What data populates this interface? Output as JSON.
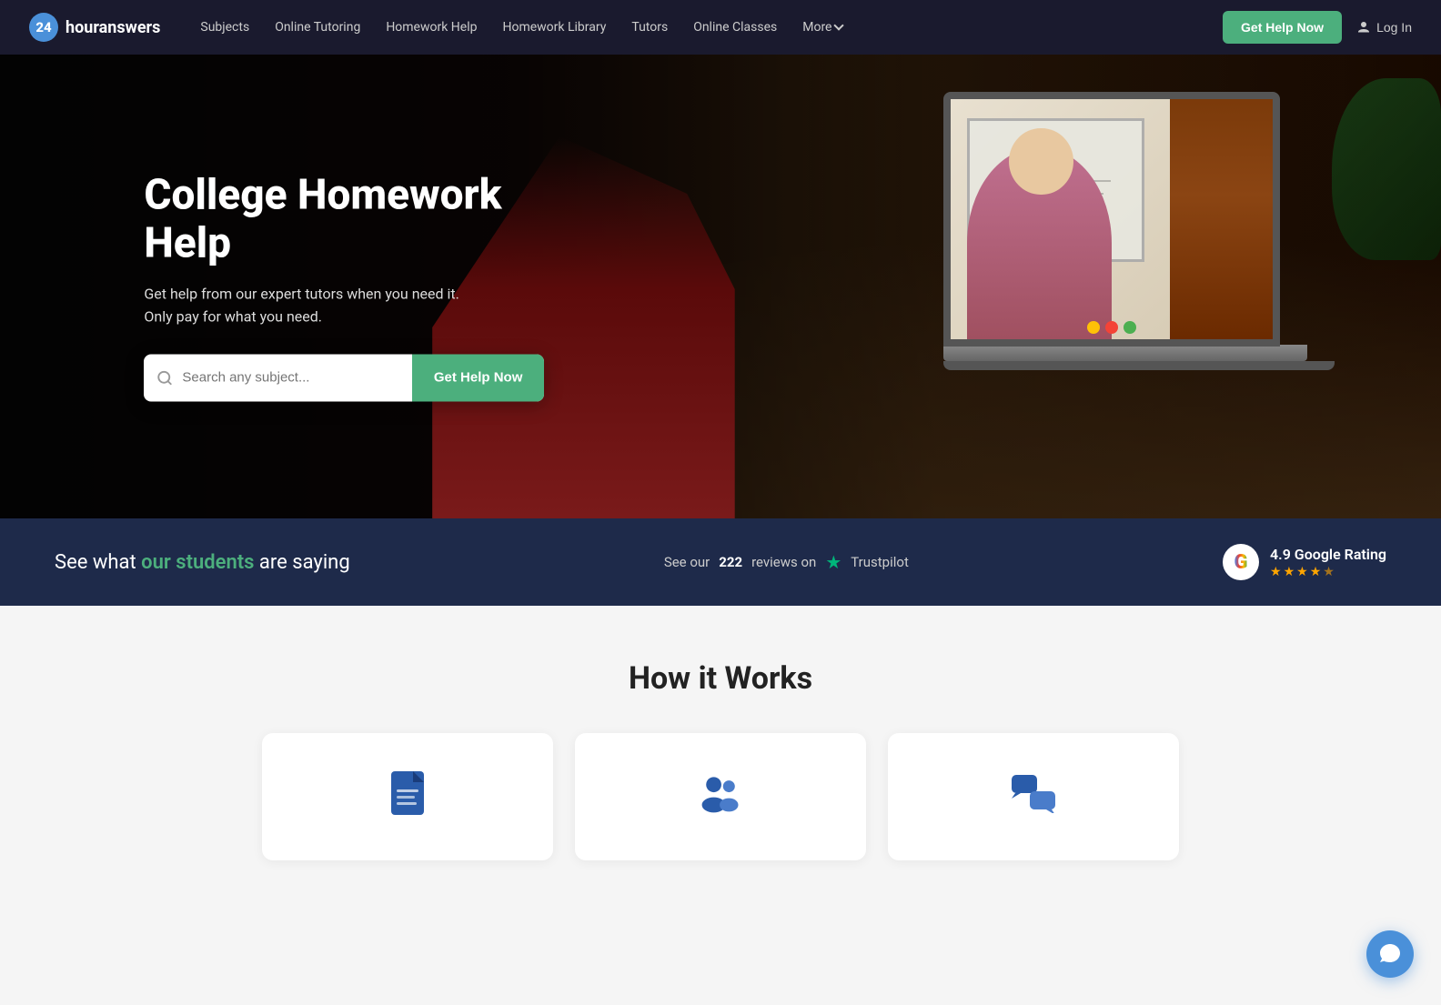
{
  "brand": {
    "badge": "24",
    "name_part1": "hour",
    "name_part2": "answers"
  },
  "navbar": {
    "links": [
      {
        "label": "Subjects",
        "id": "subjects"
      },
      {
        "label": "Online Tutoring",
        "id": "online-tutoring"
      },
      {
        "label": "Homework Help",
        "id": "homework-help"
      },
      {
        "label": "Homework Library",
        "id": "homework-library"
      },
      {
        "label": "Tutors",
        "id": "tutors"
      },
      {
        "label": "Online Classes",
        "id": "online-classes"
      },
      {
        "label": "More",
        "id": "more"
      }
    ],
    "cta_button": "Get Help Now",
    "login_label": "Log In"
  },
  "hero": {
    "title": "College Homework Help",
    "subtitle_line1": "Get help from our expert tutors when you need it.",
    "subtitle_line2": "Only pay for what you need.",
    "search_placeholder": "Search any subject...",
    "cta_button": "Get Help Now"
  },
  "social_proof": {
    "prefix": "See what",
    "highlight": "our students",
    "suffix": "are saying",
    "trustpilot_prefix": "See our",
    "trustpilot_count": "222",
    "trustpilot_suffix": "reviews on",
    "trustpilot_name": "Trustpilot",
    "google_rating": "4.9 Google Rating",
    "stars_filled": 4,
    "stars_empty": 1
  },
  "how_it_works": {
    "title": "How it Works",
    "cards": [
      {
        "id": "card-1",
        "icon": "document-icon"
      },
      {
        "id": "card-2",
        "icon": "people-icon"
      },
      {
        "id": "card-3",
        "icon": "chat-icon"
      }
    ]
  },
  "colors": {
    "green": "#4caf7d",
    "navy": "#1e2a4a",
    "blue": "#2a5caa",
    "chat_blue": "#4a90d9"
  }
}
